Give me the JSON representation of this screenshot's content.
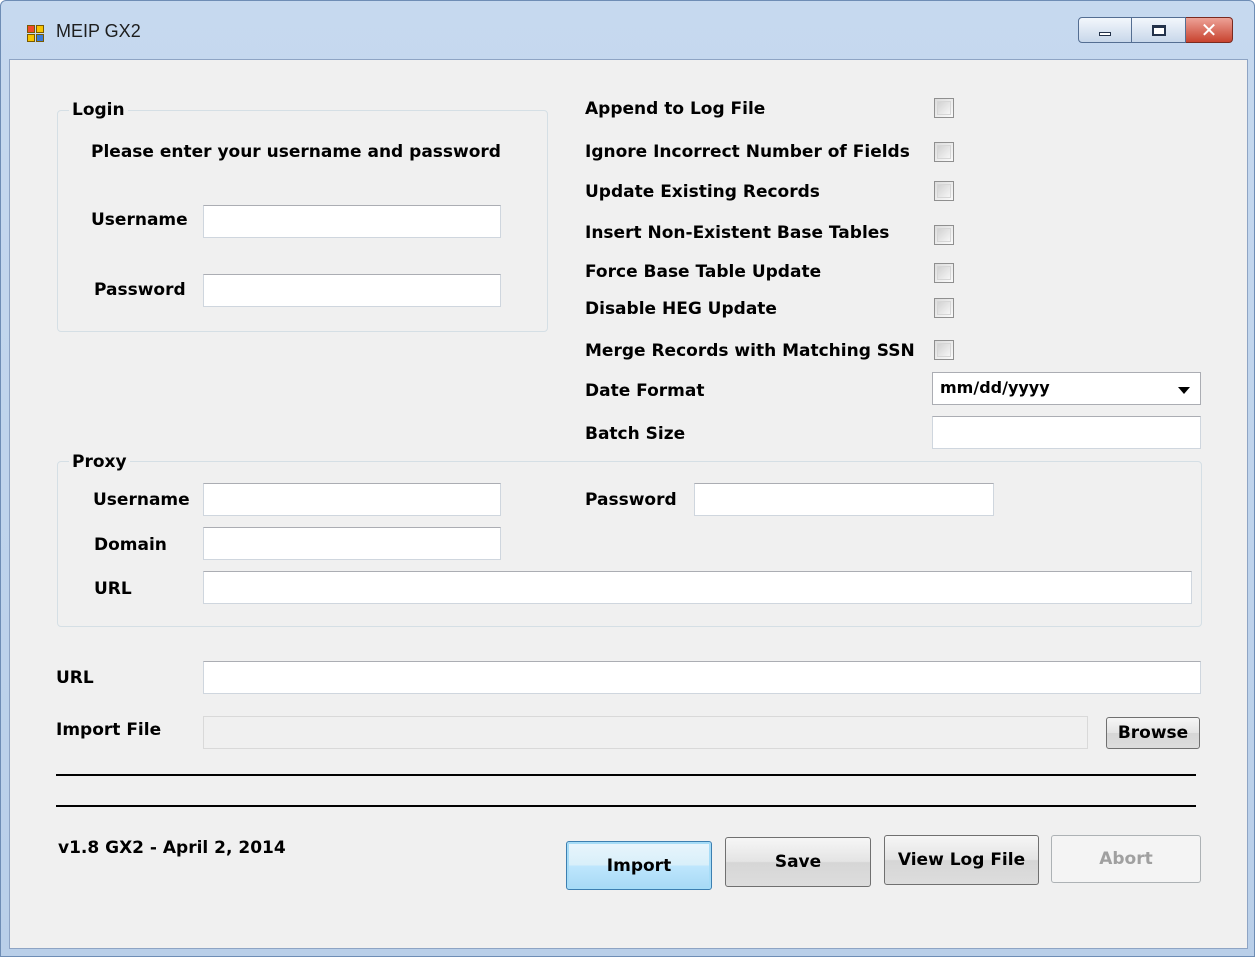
{
  "window": {
    "title": "MEIP GX2"
  },
  "login": {
    "group_title": "Login",
    "instructions": "Please enter your username and password",
    "username_label": "Username",
    "username_value": "",
    "password_label": "Password",
    "password_value": ""
  },
  "options": {
    "append_log": "Append to Log File",
    "ignore_fields": "Ignore Incorrect Number of Fields",
    "update_existing": "Update Existing Records",
    "insert_base_tables": "Insert Non-Existent Base Tables",
    "force_base_update": "Force Base Table Update",
    "disable_heg": "Disable HEG Update",
    "merge_ssn": "Merge Records with Matching SSN",
    "date_format_label": "Date Format",
    "date_format_value": "mm/dd/yyyy",
    "batch_size_label": "Batch Size",
    "batch_size_value": ""
  },
  "proxy": {
    "group_title": "Proxy",
    "username_label": "Username",
    "password_label": "Password",
    "domain_label": "Domain",
    "url_label": "URL",
    "username_value": "",
    "password_value": "",
    "domain_value": "",
    "url_value": ""
  },
  "main": {
    "url_label": "URL",
    "url_value": "",
    "import_file_label": "Import File",
    "import_file_value": "",
    "browse_label": "Browse"
  },
  "footer": {
    "version": "v1.8 GX2 - April 2, 2014",
    "import_label": "Import",
    "save_label": "Save",
    "view_log_label": "View Log File",
    "abort_label": "Abort"
  }
}
